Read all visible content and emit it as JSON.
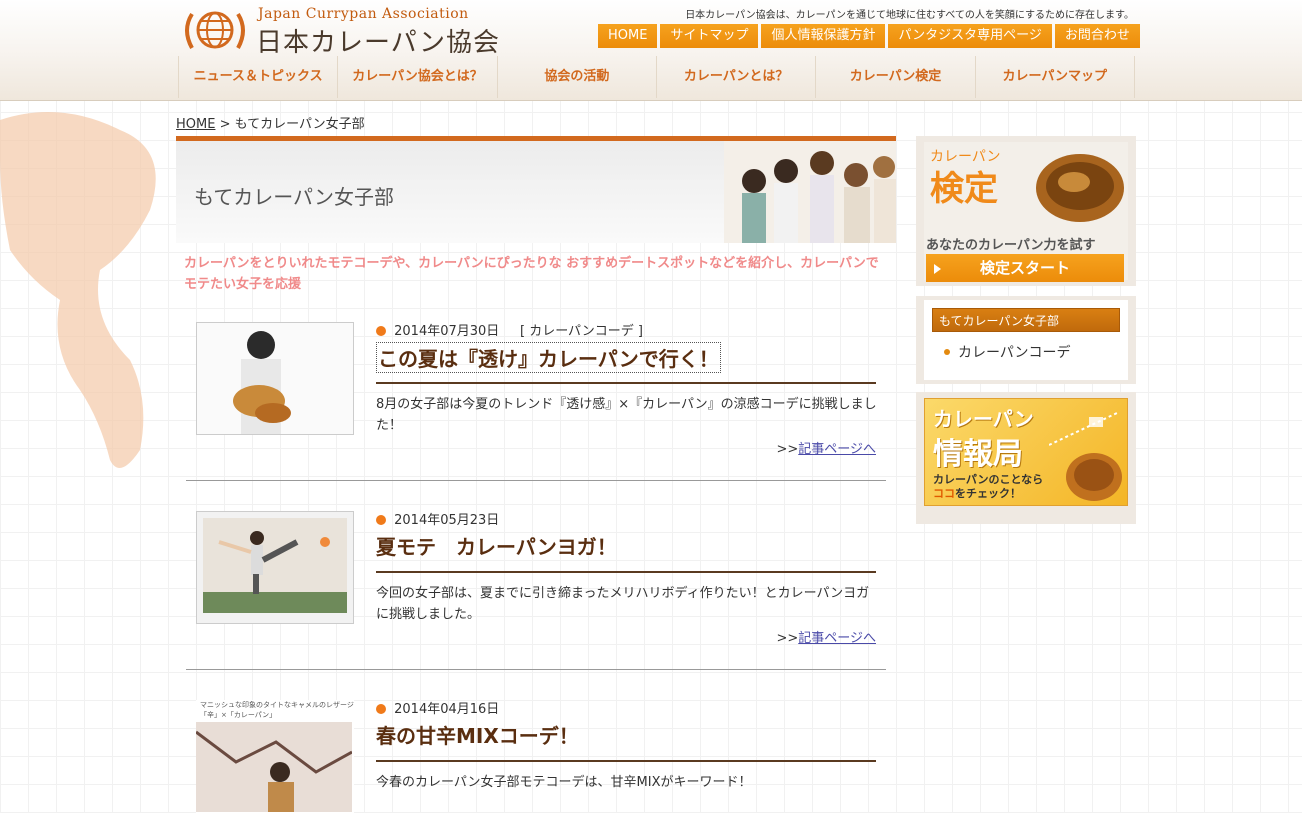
{
  "header": {
    "logo_en": "Japan Currypan Association",
    "logo_jp": "日本カレーパン協会",
    "tagline": "日本カレーパン協会は、カレーパンを通じて地球に住むすべての人を笑顔にするために存在します。",
    "top_nav": [
      "HOME",
      "サイトマップ",
      "個人情報保護方針",
      "パンタジスタ専用ページ",
      "お問合わせ"
    ],
    "main_nav": [
      "ニュース＆トピックス",
      "カレーパン協会とは？",
      "協会の活動",
      "カレーパンとは？",
      "カレーパン検定",
      "カレーパンマップ"
    ]
  },
  "breadcrumb": {
    "home": "HOME",
    "sep": ">",
    "current": "もてカレーパン女子部"
  },
  "banner": {
    "title": "もてカレーパン女子部"
  },
  "intro": "カレーパンをとりいれたモテコーデや、カレーパンにぴったりな おすすめデートスポットなどを紹介し、カレーパンでモテたい女子を応援",
  "articles": [
    {
      "date": "2014年07月30日",
      "category": "[ カレーパンコーデ ]",
      "title": "この夏は『透け』カレーパンで行く！",
      "desc": "8月の女子部は今夏のトレンド『透け感』×『カレーパン』の涼感コーデに挑戦しました！",
      "more_prefix": ">>",
      "more": "記事ページへ"
    },
    {
      "date": "2014年05月23日",
      "category": "",
      "title": "夏モテ　カレーパンヨガ！",
      "desc": "今回の女子部は、夏までに引き締まったメリハリボディ作りたい！とカレーパンヨガに挑戦しました。",
      "more_prefix": ">>",
      "more": "記事ページへ"
    },
    {
      "date": "2014年04月16日",
      "category": "",
      "title": "春の甘辛MIXコーデ！",
      "desc": "今春のカレーパン女子部モテコーデは、甘辛MIXがキーワード！",
      "thumb_caption": "マニッシュな印象のタイトなキャメルのレザージャケット",
      "thumb_caption2": "「辛」×「カレーパン」",
      "more_prefix": "",
      "more": ""
    }
  ],
  "sidebar": {
    "kentei_small": "カレーパン",
    "kentei_logo": "検定",
    "kentei_sub": "あなたのカレーパン力を試す",
    "kentei_btn": "検定スタート",
    "cat_head": "もてカレーパン女子部",
    "cat_item": "カレーパンコーデ",
    "info_t1": "カレーパン",
    "info_t2": "情報局",
    "info_t3a": "カレーパンのことなら",
    "info_t3b_accent": "ココ",
    "info_t3b": "をチェック！"
  },
  "colors": {
    "accent": "#ec8c0a",
    "brand_brown": "#5a2e10",
    "intro_pink": "#f08a8a"
  }
}
